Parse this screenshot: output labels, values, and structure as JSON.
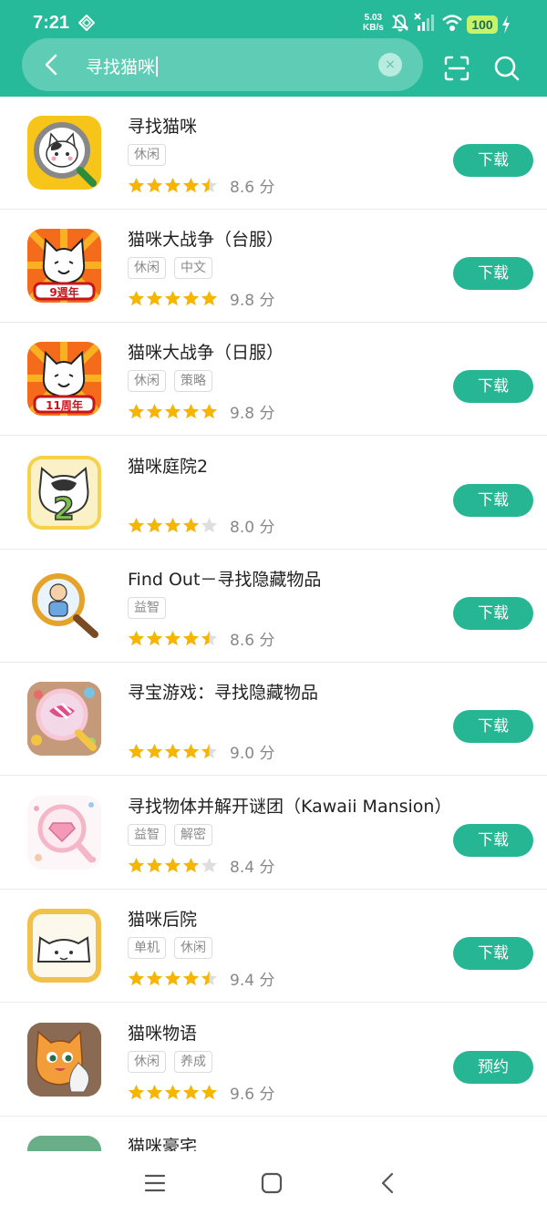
{
  "status": {
    "time": "7:21",
    "net_speed": "5.03",
    "net_unit": "KB/s",
    "battery": "100",
    "icons": [
      "diamond-icon",
      "mute-bell-icon",
      "signal-off-icon",
      "wifi-icon",
      "battery-icon",
      "charging-icon"
    ]
  },
  "search": {
    "query": "寻找猫咪",
    "clear_label": "×",
    "back_icon": "chevron-left-icon",
    "scan_icon": "scan-icon",
    "search_icon": "search-icon",
    "accent": "#26b99a"
  },
  "apps": [
    {
      "name": "寻找猫咪",
      "tags": [
        "休闲"
      ],
      "rating": 4.5,
      "score": "8.6 分",
      "button": "下载",
      "icon": "cat-magnifier-icon"
    },
    {
      "name": "猫咪大战争（台服）",
      "tags": [
        "休闲",
        "中文"
      ],
      "rating": 5,
      "score": "9.8 分",
      "button": "下载",
      "icon": "battle-cat-icon",
      "badge": "9週年"
    },
    {
      "name": "猫咪大战争（日服）",
      "tags": [
        "休闲",
        "策略"
      ],
      "rating": 5,
      "score": "9.8 分",
      "button": "下载",
      "icon": "battle-cat-icon",
      "badge": "11周年"
    },
    {
      "name": "猫咪庭院2",
      "tags": [],
      "rating": 4,
      "score": "8.0 分",
      "button": "下载",
      "icon": "cat-2-icon"
    },
    {
      "name": "Find Out－寻找隐藏物品",
      "tags": [
        "益智"
      ],
      "rating": 4.5,
      "score": "8.6 分",
      "button": "下载",
      "icon": "magnifier-kid-icon"
    },
    {
      "name": "寻宝游戏：寻找隐藏物品",
      "tags": [],
      "rating": 4.5,
      "score": "9.0 分",
      "button": "下载",
      "icon": "candy-magnifier-icon"
    },
    {
      "name": "寻找物体并解开谜团（Kawaii Mansion）",
      "tags": [
        "益智",
        "解密"
      ],
      "rating": 4,
      "score": "8.4 分",
      "button": "下载",
      "icon": "diamond-magnifier-icon"
    },
    {
      "name": "猫咪后院",
      "tags": [
        "单机",
        "休闲"
      ],
      "rating": 4.5,
      "score": "9.4 分",
      "button": "下载",
      "icon": "neko-cat-icon"
    },
    {
      "name": "猫咪物语",
      "tags": [
        "休闲",
        "养成"
      ],
      "rating": 5,
      "score": "9.6 分",
      "button": "预约",
      "icon": "orange-cat-icon"
    },
    {
      "name": "猫咪豪宅",
      "tags": [],
      "rating": 0,
      "score": "",
      "button": "",
      "icon": "green-app-icon"
    }
  ],
  "nav": {
    "menu": "menu-icon",
    "home": "home-icon",
    "back": "back-icon"
  }
}
